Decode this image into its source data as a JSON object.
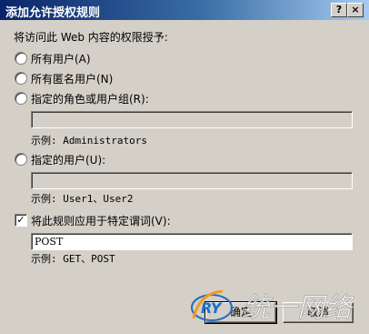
{
  "dialog": {
    "title": "添加允许授权规则",
    "help_glyph": "?",
    "close_glyph": "×"
  },
  "intro": "将访问此 Web 内容的权限授予:",
  "options": {
    "all_users": "所有用户(A)",
    "anonymous_users": "所有匿名用户(N)",
    "roles_groups": "指定的角色或用户组(R):",
    "roles_example": "示例: Administrators",
    "specified_users": "指定的用户(U):",
    "users_example": "示例: User1、User2"
  },
  "verbs": {
    "checkbox_label": "将此规则应用于特定谓词(V):",
    "checked_glyph": "✓",
    "value": "POST",
    "example": "示例: GET、POST"
  },
  "buttons": {
    "ok": "确定",
    "cancel": "取消"
  },
  "watermark": {
    "logo_text": "RY",
    "tagline": "统一网络"
  }
}
